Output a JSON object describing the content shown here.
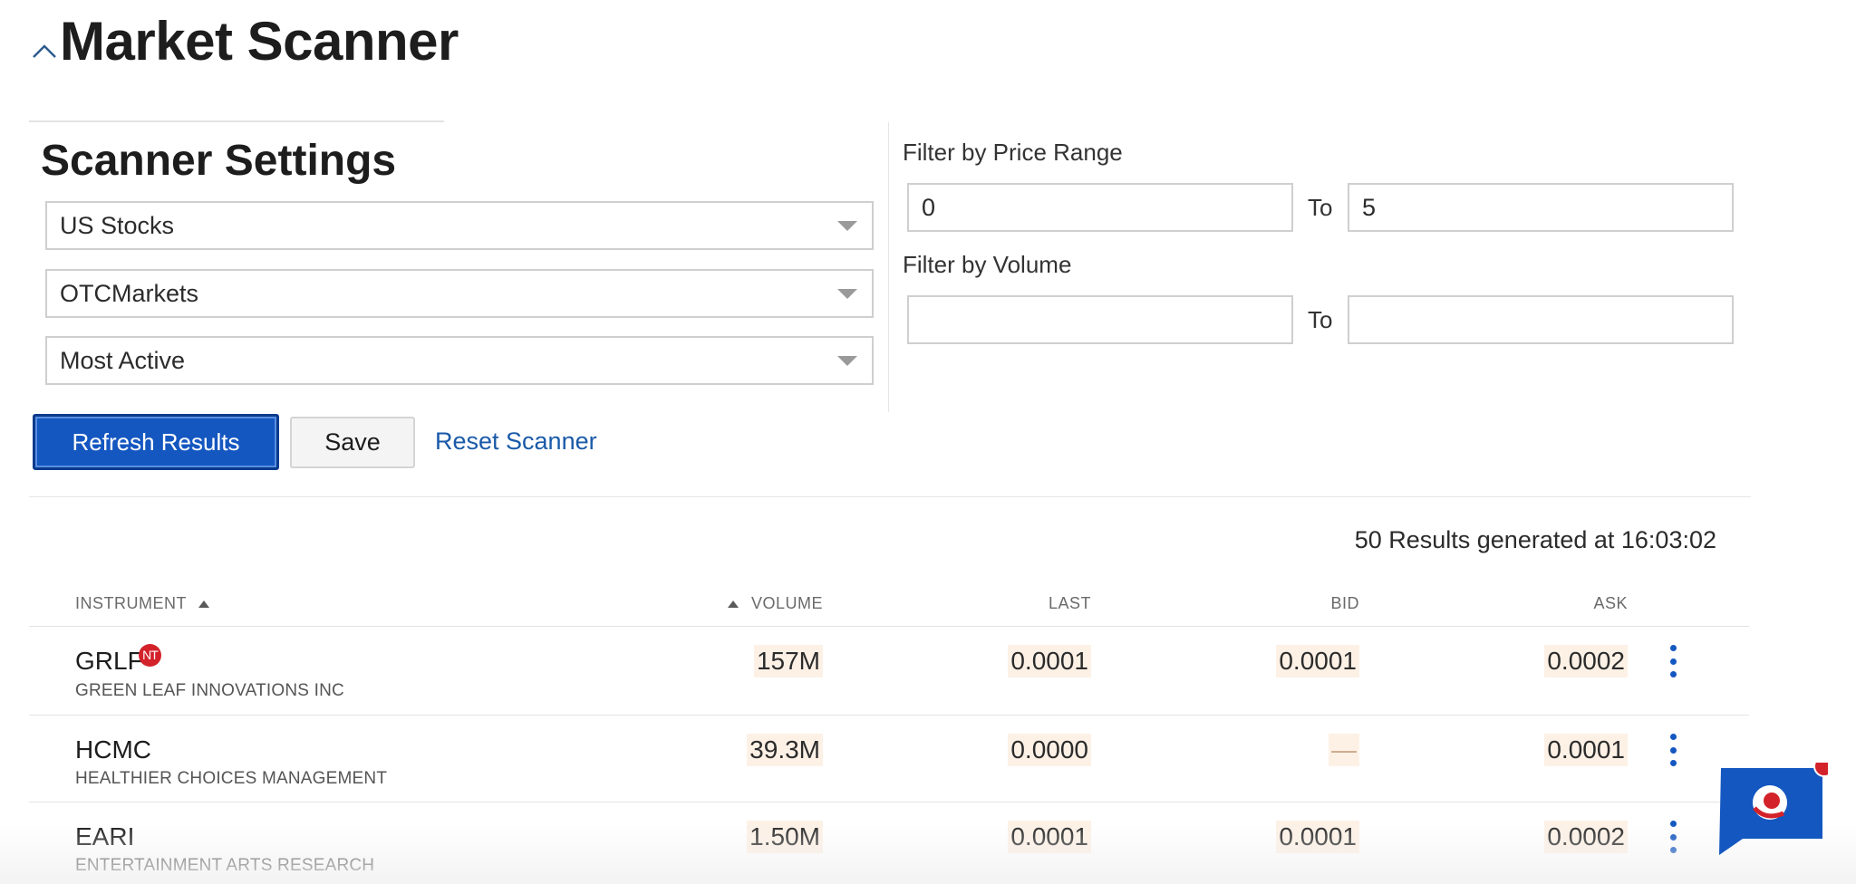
{
  "header": {
    "title": "Market Scanner"
  },
  "settings": {
    "title": "Scanner Settings",
    "instrument_type": "US Stocks",
    "location": "OTCMarkets",
    "scan_type": "Most Active"
  },
  "filters": {
    "price_label": "Filter by Price Range",
    "price_from": "0",
    "price_to": "5",
    "volume_label": "Filter by Volume",
    "volume_from": "",
    "volume_to": "",
    "to_label": "To"
  },
  "actions": {
    "refresh_label": "Refresh Results",
    "save_label": "Save",
    "reset_label": "Reset Scanner"
  },
  "results": {
    "summary": "50 Results generated at 16:03:02",
    "columns": {
      "instrument": "INSTRUMENT",
      "volume": "VOLUME",
      "last": "LAST",
      "bid": "BID",
      "ask": "ASK"
    },
    "rows": [
      {
        "symbol": "GRLF",
        "badge": "NT",
        "company": "GREEN LEAF INNOVATIONS INC",
        "volume": "157M",
        "last": "0.0001",
        "bid": "0.0001",
        "ask": "0.0002"
      },
      {
        "symbol": "HCMC",
        "company": "HEALTHIER CHOICES MANAGEMENT",
        "volume": "39.3M",
        "last": "0.0000",
        "bid": "—",
        "ask": "0.0001"
      },
      {
        "symbol": "EARI",
        "company": "ENTERTAINMENT ARTS RESEARCH",
        "volume": "1.50M",
        "last": "0.0001",
        "bid": "0.0001",
        "ask": "0.0002"
      }
    ]
  },
  "icons": {
    "collapse": "chevron-up-icon",
    "dropdown": "caret-down-icon",
    "sort": "triangle-up-icon",
    "row_menu": "kebab-menu-icon",
    "chat": "chat-bubble-icon"
  },
  "colors": {
    "primary": "#1457c0",
    "link": "#1a5aa8",
    "badge": "#d3222a",
    "cell_highlight": "#fdf1e6"
  }
}
